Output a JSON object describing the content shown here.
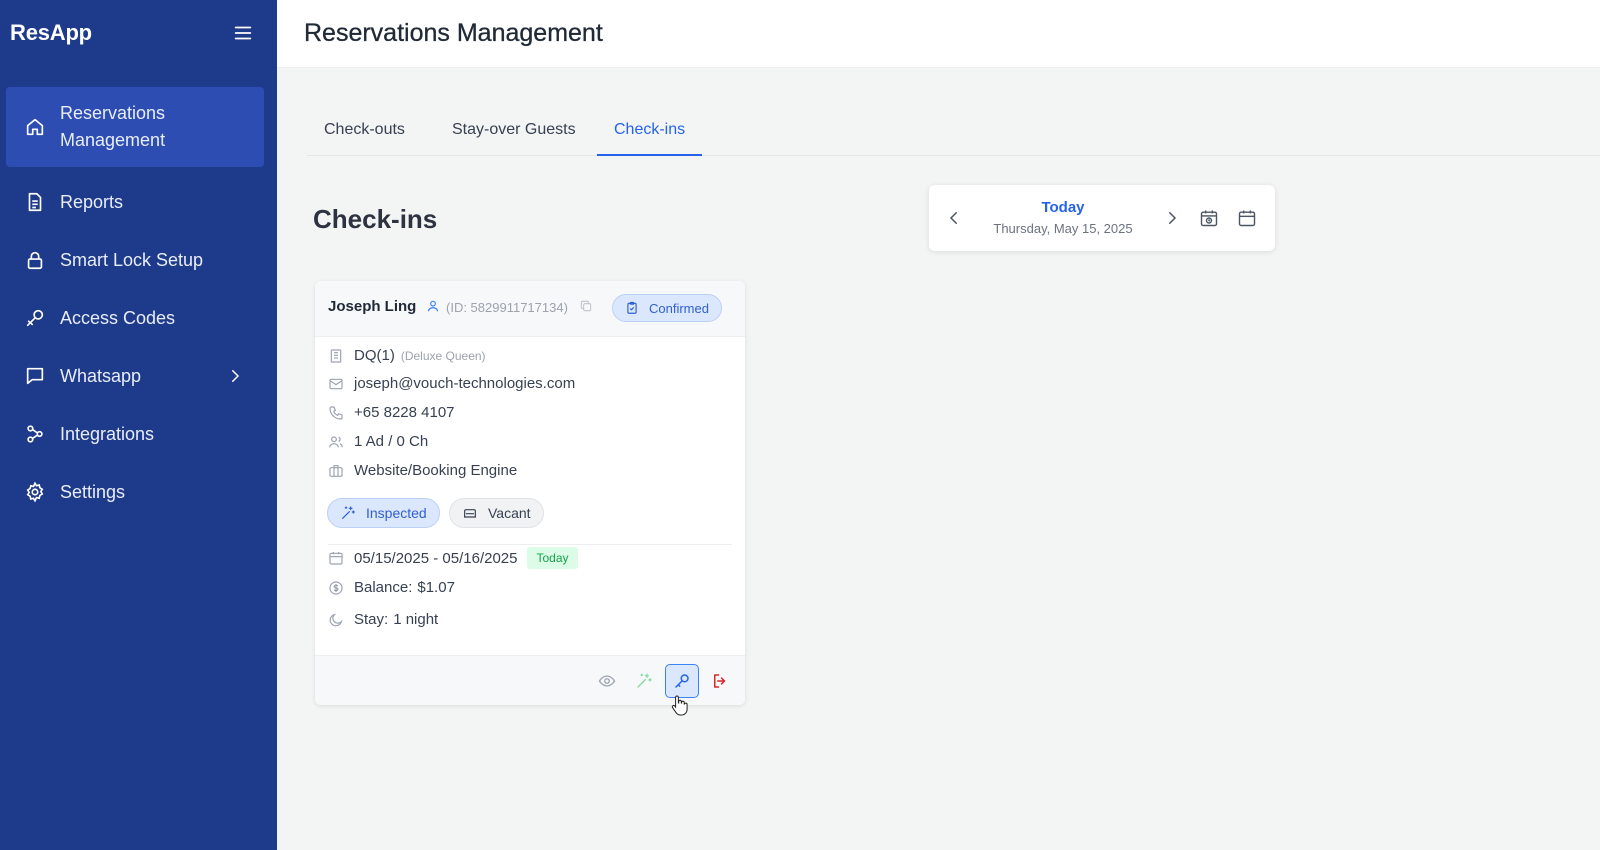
{
  "app": {
    "brand": "ResApp"
  },
  "sidebar": {
    "items": [
      {
        "label": "Reservations Management",
        "icon": "home-icon",
        "active": true
      },
      {
        "label": "Reports",
        "icon": "document-icon"
      },
      {
        "label": "Smart Lock Setup",
        "icon": "lock-icon"
      },
      {
        "label": "Access Codes",
        "icon": "key-icon"
      },
      {
        "label": "Whatsapp",
        "icon": "chat-icon",
        "has_submenu": true
      },
      {
        "label": "Integrations",
        "icon": "integrations-icon"
      },
      {
        "label": "Settings",
        "icon": "gear-icon"
      }
    ]
  },
  "header": {
    "title": "Reservations Management"
  },
  "tabs": [
    {
      "label": "Check-outs"
    },
    {
      "label": "Stay-over Guests"
    },
    {
      "label": "Check-ins",
      "active": true
    }
  ],
  "section": {
    "title": "Check-ins"
  },
  "date_picker": {
    "label": "Today",
    "date": "Thursday, May 15, 2025"
  },
  "reservation": {
    "guest_name": "Joseph Ling",
    "guest_id": "(ID: 5829911717134)",
    "status": "Confirmed",
    "room": "DQ(1)",
    "room_type": "(Deluxe Queen)",
    "email": "joseph@vouch-technologies.com",
    "phone": "+65 8228 4107",
    "occupancy": "1 Ad / 0 Ch",
    "source": "Website/Booking Engine",
    "housekeeping": "Inspected",
    "room_state": "Vacant",
    "dates": "05/15/2025 - 05/16/2025",
    "today_badge": "Today",
    "balance_label": "Balance:",
    "balance": "$1.07",
    "stay_label": "Stay:",
    "stay": "1 night"
  },
  "colors": {
    "sidebar_bg": "#1e3a8a",
    "sidebar_active": "#2d4db2",
    "accent": "#2563eb",
    "success": "#16a34a",
    "danger": "#dc2626"
  }
}
